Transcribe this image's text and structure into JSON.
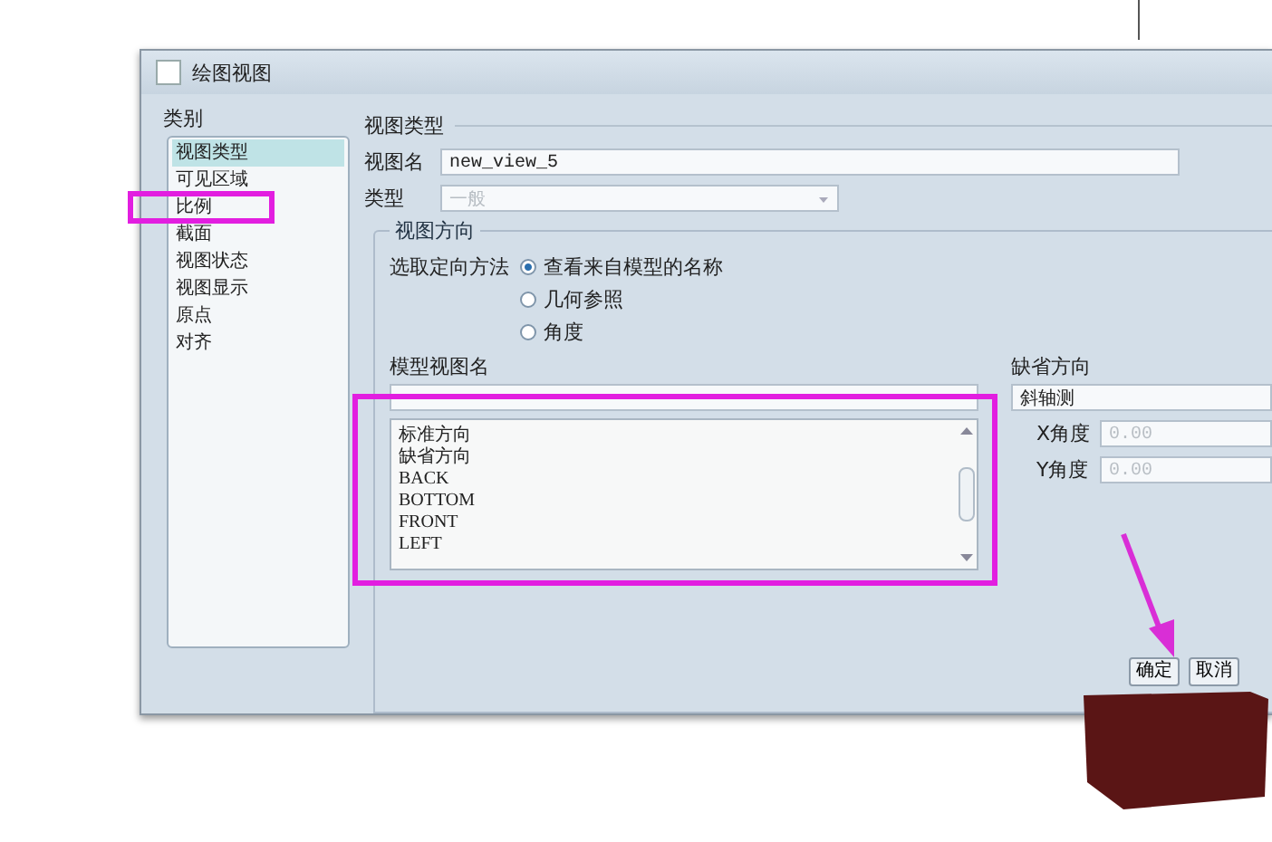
{
  "window": {
    "title": "绘图视图"
  },
  "categories": {
    "label": "类别",
    "items": [
      {
        "label": "视图类型",
        "selected": true
      },
      {
        "label": "可见区域",
        "selected": false
      },
      {
        "label": "比例",
        "selected": false
      },
      {
        "label": "截面",
        "selected": false
      },
      {
        "label": "视图状态",
        "selected": false
      },
      {
        "label": "视图显示",
        "selected": false
      },
      {
        "label": "原点",
        "selected": false
      },
      {
        "label": "对齐",
        "selected": false
      }
    ]
  },
  "view_type": {
    "heading": "视图类型",
    "name_label": "视图名",
    "name_value": "new_view_5",
    "type_label": "类型",
    "type_value": "一般",
    "type_disabled": true
  },
  "orientation": {
    "heading": "视图方向",
    "method_label": "选取定向方法",
    "methods": [
      {
        "label": "查看来自模型的名称",
        "selected": true
      },
      {
        "label": "几何参照",
        "selected": false
      },
      {
        "label": "角度",
        "selected": false
      }
    ],
    "model_view_label": "模型视图名",
    "model_views": [
      "标准方向",
      "缺省方向",
      "BACK",
      "BOTTOM",
      "FRONT",
      "LEFT"
    ],
    "default_label": "缺省方向",
    "default_value": "斜轴测",
    "angles": [
      {
        "label": "X角度",
        "value": "0.00",
        "disabled": true
      },
      {
        "label": "Y角度",
        "value": "0.00",
        "disabled": true
      }
    ]
  },
  "buttons": [
    "确定",
    "取消"
  ],
  "annotations": [
    {
      "kind": "box"
    },
    {
      "kind": "box"
    },
    {
      "kind": "arrow"
    },
    {
      "kind": "scribble"
    }
  ]
}
